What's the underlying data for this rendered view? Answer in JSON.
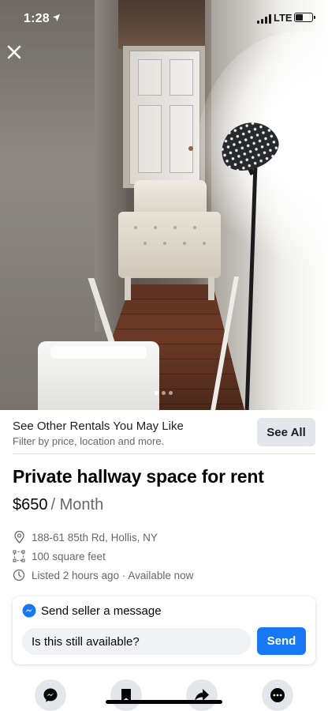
{
  "status_bar": {
    "time": "1:28",
    "network": "LTE",
    "battery_level": 0.45,
    "signal_bars": 4
  },
  "photo": {
    "description_icon": "close-icon",
    "carousel_count": 3,
    "carousel_active_index": 0
  },
  "promo": {
    "title": "See Other Rentals You May Like",
    "subtitle": "Filter by price, location and more.",
    "button_label": "See All"
  },
  "listing": {
    "title": "Private hallway space for rent",
    "price": "$650",
    "price_period": "/ Month",
    "address": "188-61 85th Rd, Hollis, NY",
    "size": "100 square feet",
    "listed": "Listed 2 hours ago · Available now"
  },
  "message": {
    "heading": "Send seller a message",
    "input_value": "Is this still available?",
    "send_label": "Send"
  },
  "actions": {
    "items": [
      "messenger-icon",
      "save-icon",
      "share-icon",
      "more-icon"
    ]
  },
  "colors": {
    "accent": "#1877f2",
    "secondary_text": "#65676b",
    "button_bg": "#e4e6eb"
  }
}
